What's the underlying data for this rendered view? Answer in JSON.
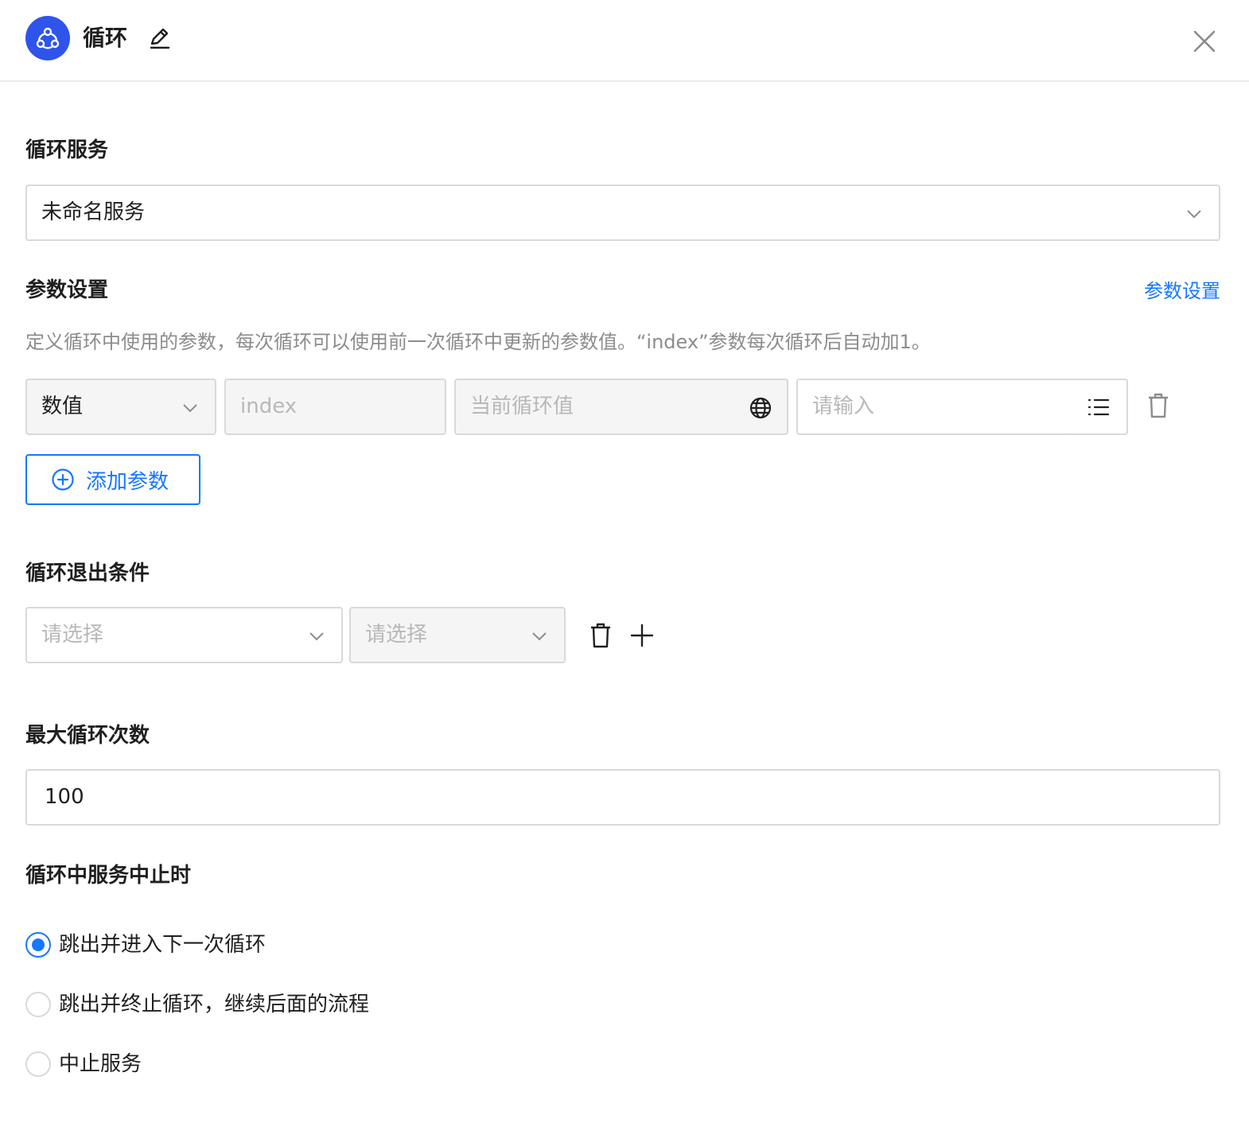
{
  "header": {
    "title": "循环",
    "logo_icon": "loop-nodes-icon",
    "edit_icon": "pencil-icon",
    "close_icon": "close-icon",
    "brand_color": "#2f54eb"
  },
  "loop_service": {
    "label": "循环服务",
    "selected": "未命名服务"
  },
  "params": {
    "label": "参数设置",
    "link": "参数设置",
    "description": "定义循环中使用的参数，每次循环可以使用前一次循环中更新的参数值。“index”参数每次循环后自动加1。",
    "row": {
      "type": "数值",
      "name": "index",
      "value": "当前循环值",
      "input_placeholder": "请输入"
    },
    "add_button": "添加参数",
    "accent_color": "#1677ff"
  },
  "exit_condition": {
    "label": "循环退出条件",
    "select1_placeholder": "请选择",
    "select2_placeholder": "请选择"
  },
  "max_loops": {
    "label": "最大循环次数",
    "value": "100"
  },
  "on_abort": {
    "label": "循环中服务中止时",
    "options": [
      {
        "label": "跳出并进入下一次循环",
        "checked": true
      },
      {
        "label": "跳出并终止循环，继续后面的流程",
        "checked": false
      },
      {
        "label": "中止服务",
        "checked": false
      }
    ]
  }
}
